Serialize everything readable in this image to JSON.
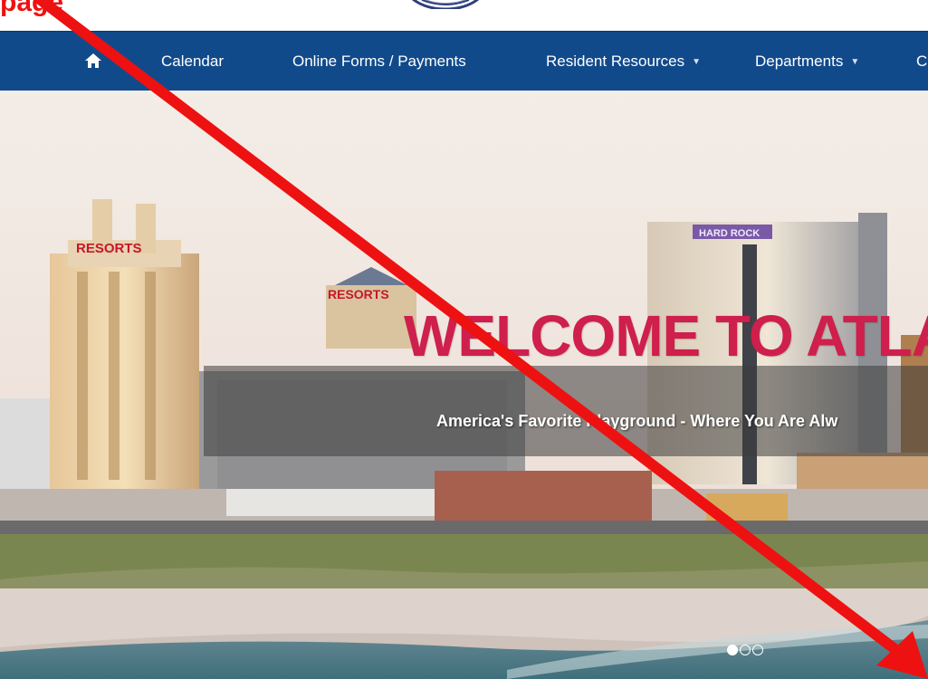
{
  "annotation": {
    "text": "page",
    "color": "#ee1111"
  },
  "nav": {
    "items": [
      {
        "label": "Calendar"
      },
      {
        "label": "Online Forms / Payments"
      },
      {
        "label": "Resident Resources",
        "dropdown": true
      },
      {
        "label": "Departments",
        "dropdown": true
      },
      {
        "label": "C"
      }
    ],
    "caret": "▼",
    "background": "#114a8b"
  },
  "hero": {
    "title": "WELCOME TO ATLANT",
    "subtitle": "America's Favorite Playground - Where You Are Alw",
    "sign_resorts": "RESORTS",
    "sign_hard_rock": "HARD ROCK",
    "title_color": "#cf1f4c",
    "carousel": {
      "slides": 3,
      "active": 0
    }
  }
}
